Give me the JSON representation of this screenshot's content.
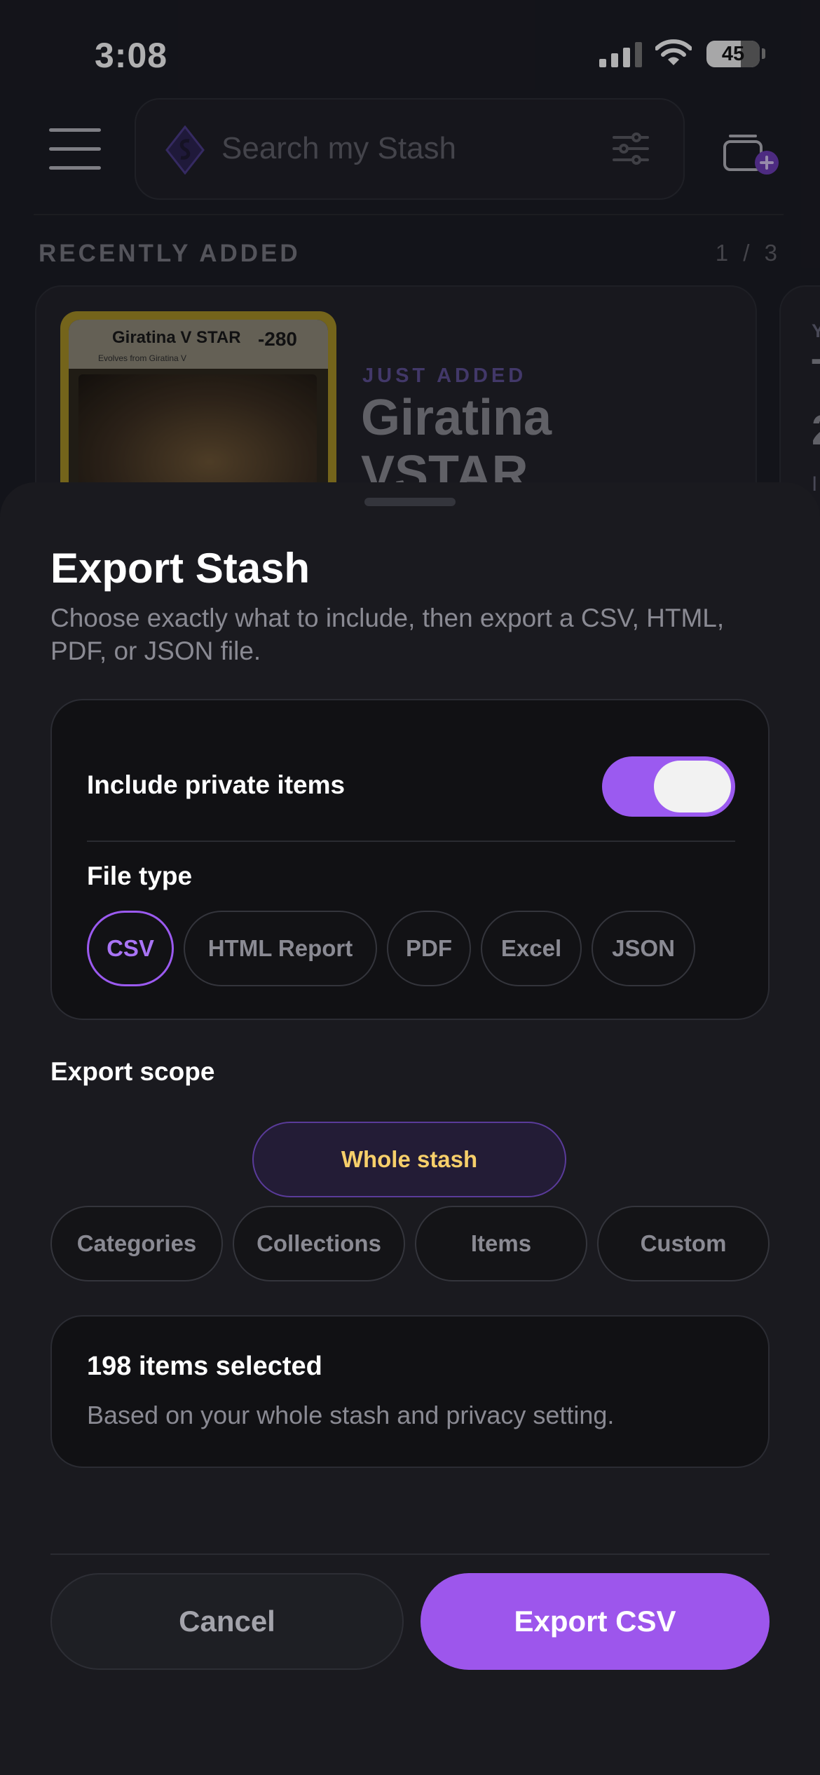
{
  "status_bar": {
    "time": "3:08",
    "battery": "45"
  },
  "header": {
    "search_placeholder": "Search my Stash"
  },
  "recent": {
    "title": "RECENTLY ADDED",
    "pager": "1 / 3",
    "card": {
      "badge": "JUST ADDED",
      "title_line1": "Giratina",
      "title_line2": "VSTAR",
      "card_name": "Giratina V",
      "card_suffix": "STAR",
      "card_hp": "-280",
      "card_subtext": "Evolves from Giratina V"
    },
    "next_card": {
      "c1": "Y",
      "c2": "T",
      "c3": "2",
      "c4": "I"
    }
  },
  "sheet": {
    "title": "Export Stash",
    "subtitle": "Choose exactly what to include, then export a CSV, HTML, PDF, or JSON file.",
    "private_label": "Include private items",
    "private_enabled": true,
    "file_type_label": "File type",
    "file_types": [
      "CSV",
      "HTML Report",
      "PDF",
      "Excel",
      "JSON"
    ],
    "selected_file_type": "CSV",
    "scope_label": "Export scope",
    "scope_primary": "Whole stash",
    "scope_options": [
      "Categories",
      "Collections",
      "Items",
      "Custom"
    ],
    "selected_scope": "Whole stash",
    "summary_count": "198 items selected",
    "summary_note": "Based on your whole stash and privacy setting.",
    "cancel_label": "Cancel",
    "export_label": "Export CSV"
  },
  "colors": {
    "accent": "#9b5af0",
    "scope_active_text": "#f6cf6a",
    "background": "#1a1a1f"
  }
}
